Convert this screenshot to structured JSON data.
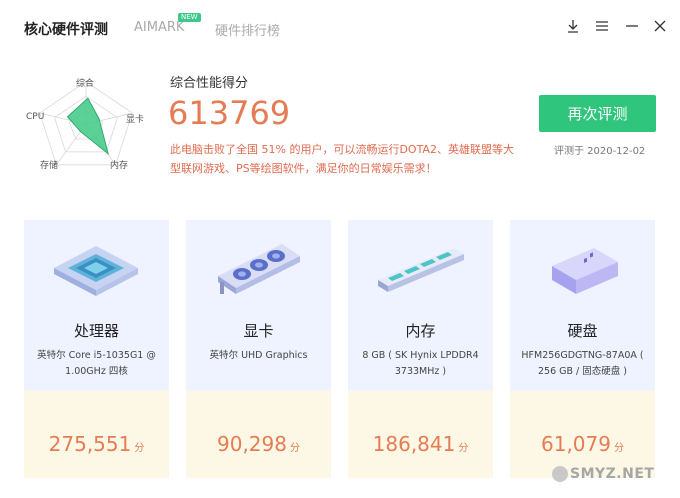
{
  "header": {
    "tabs": [
      {
        "label": "核心硬件评测",
        "active": true
      },
      {
        "label": "AIMARK",
        "badge": "NEW",
        "active": false
      },
      {
        "label": "硬件排行榜",
        "active": false
      }
    ],
    "window_icons": [
      "download-icon",
      "menu-icon",
      "minimize-icon",
      "close-icon"
    ]
  },
  "radar": {
    "labels": {
      "top": "综合",
      "left": "CPU",
      "right": "显卡",
      "bottom_left": "存储",
      "bottom_right": "内存"
    }
  },
  "score": {
    "caption": "综合性能得分",
    "value": "613769",
    "description": "此电脑击败了全国 51% 的用户，可以流畅运行DOTA2、英雄联盟等大型联网游戏、PS等绘图软件，满足你的日常娱乐需求！"
  },
  "actions": {
    "retest_label": "再次评测",
    "test_date": "评测于 2020-12-02"
  },
  "cards": [
    {
      "title": "处理器",
      "spec": "英特尔 Core i5-1035G1 @ 1.00GHz 四核",
      "score": "275,551",
      "unit": "分",
      "icon": "cpu-chip-icon"
    },
    {
      "title": "显卡",
      "spec": "英特尔 UHD Graphics",
      "score": "90,298",
      "unit": "分",
      "icon": "graphics-card-icon"
    },
    {
      "title": "内存",
      "spec": "8 GB ( SK Hynix LPDDR4 3733MHz )",
      "score": "186,841",
      "unit": "分",
      "icon": "memory-stick-icon"
    },
    {
      "title": "硬盘",
      "spec": "HFM256GDGTNG-87A0A ( 256 GB / 固态硬盘 )",
      "score": "61,079",
      "unit": "分",
      "icon": "ssd-drive-icon"
    }
  ],
  "watermark": "SMYZ.NET",
  "colors": {
    "accent_green": "#2fc57c",
    "score_orange": "#e57c53",
    "desc_red": "#e06b4e",
    "card_blue": "#eef3ff",
    "card_yellow": "#fdf8e6"
  }
}
